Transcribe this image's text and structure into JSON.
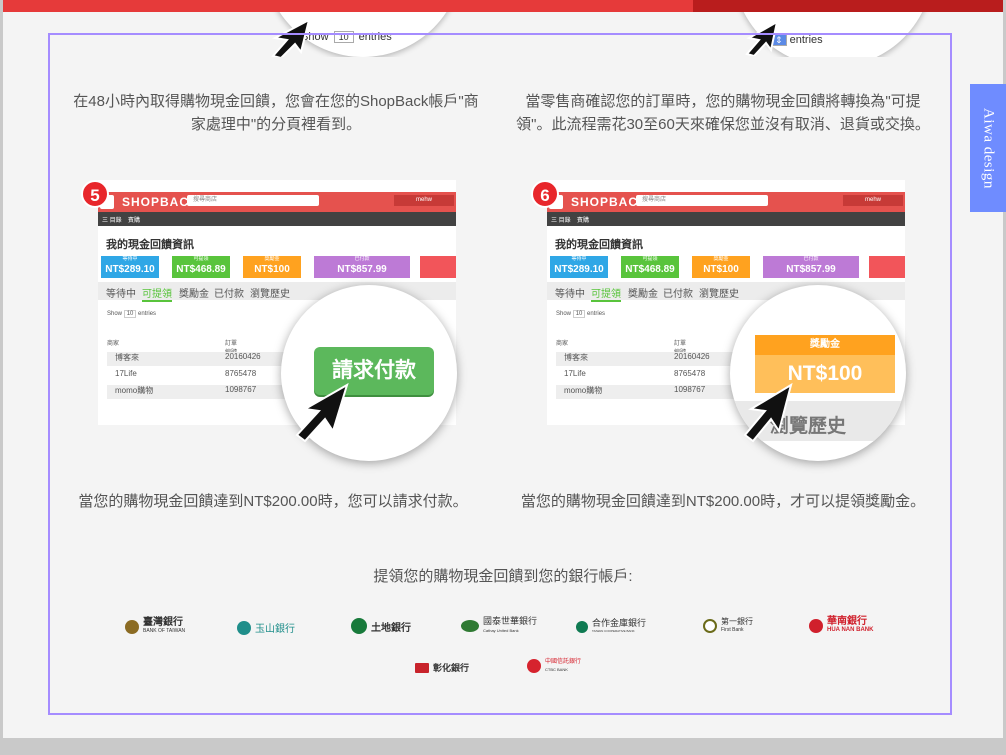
{
  "side_tab": "Aiwa design",
  "top_snippet": {
    "show": "Show",
    "entries_select": "10",
    "entries": "entries"
  },
  "captions": {
    "step3": "在48小時內取得購物現金回饋，您會在您的ShopBack帳戶\"商家處理中\"的分頁裡看到。",
    "step4": "當零售商確認您的訂單時，您的購物現金回饋將轉換為\"可提領\"。此流程需花30至60天來確保您並沒有取消、退貨或交換。",
    "step5": "當您的購物現金回饋達到NT$200.00時，您可以請求付款。",
    "step6": "當您的購物現金回饋達到NT$200.00時，才可以提領獎勵金。",
    "banks_heading": "提領您的購物現金回饋到您的銀行帳戶:"
  },
  "shopback": {
    "logo": "SHOPBACK",
    "search_placeholder": "搜尋商店",
    "user": "mehw",
    "nav": "三 目錄",
    "nav2": "賓購",
    "title": "我的現金回饋資訊",
    "stats": [
      {
        "label": "等待中",
        "value": "NT$289.10",
        "color": "#2fa7e6"
      },
      {
        "label": "可提領",
        "value": "NT$468.89",
        "color": "#59c43c"
      },
      {
        "label": "獎勵金",
        "value": "NT$100",
        "color": "#ffa21f"
      },
      {
        "label": "已付款",
        "value": "NT$857.99",
        "color": "#bd7ad6"
      }
    ],
    "tabs": [
      "等待中",
      "可提領",
      "獎勵金",
      "已付款",
      "瀏覽歷史"
    ],
    "show": "Show",
    "entries_select": "10",
    "entries": "entries",
    "col_store": "商家",
    "col_order": "訂單編號",
    "rows": [
      {
        "store": "博客來",
        "order": "20160426"
      },
      {
        "store": "17Life",
        "order": "8765478"
      },
      {
        "store": "momo購物",
        "order": "1098767"
      }
    ]
  },
  "step5": {
    "badge": "5",
    "zoom_button": "請求付款"
  },
  "step6": {
    "badge": "6",
    "zoom_label": "獎勵金",
    "zoom_value": "NT$100",
    "zoom_tab": "瀏覽歷史"
  },
  "banks": [
    {
      "name": "臺灣銀行",
      "sub": "BANK OF TAIWAN",
      "color": "#8b6b23"
    },
    {
      "name": "玉山銀行",
      "sub": "",
      "color": "#1f8e8a"
    },
    {
      "name": "土地銀行",
      "sub": "",
      "color": "#187a3b"
    },
    {
      "name": "國泰世華銀行",
      "sub": "Cathay United Bank",
      "color": "#2f7a33"
    },
    {
      "name": "合作金庫銀行",
      "sub": "TAIWAN COOPERATIVE BANK",
      "color": "#0f7a52"
    },
    {
      "name": "第一銀行",
      "sub": "First Bank",
      "color": "#6b6b1a"
    },
    {
      "name": "華南銀行",
      "sub": "HUA NAN BANK",
      "color": "#d0202c"
    },
    {
      "name": "彰化銀行",
      "sub": "",
      "color": "#c8232b"
    },
    {
      "name": "中國信託銀行",
      "sub": "CTBC BANK",
      "color": "#d6232e"
    }
  ]
}
